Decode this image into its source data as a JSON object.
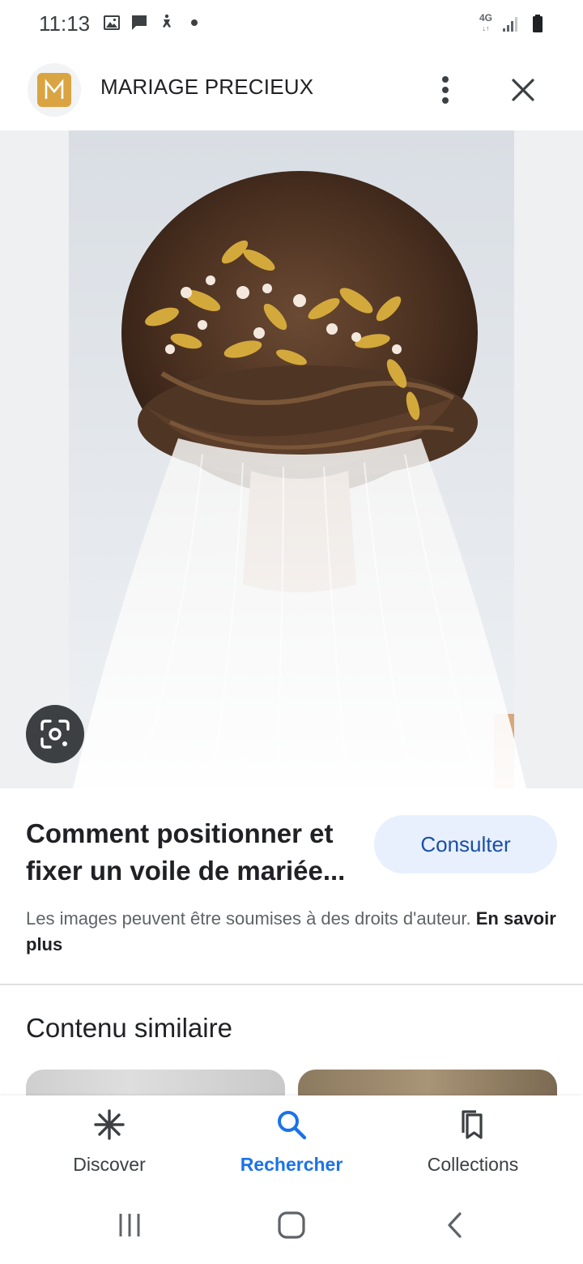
{
  "status_bar": {
    "time": "11:13",
    "network": "4G",
    "left_icons": [
      "gallery-icon",
      "message-icon",
      "accessibility-icon",
      "dot-icon"
    ],
    "right_icons": [
      "network-4g-icon",
      "signal-icon",
      "battery-icon"
    ]
  },
  "header": {
    "site_name": "MARIAGE PRECIEUX",
    "logo_letter": "M",
    "brand_color": "#d9a441"
  },
  "image": {
    "icon": "lens-icon"
  },
  "result": {
    "title": "Comment positionner et fixer un voile de mariée...",
    "consult_label": "Consulter",
    "copyright_text": "Les images peuvent être soumises à des droits d'auteur.",
    "learn_more": "En savoir plus"
  },
  "similar": {
    "heading": "Contenu similaire"
  },
  "bottom_nav": {
    "items": [
      {
        "label": "Discover",
        "icon": "asterisk-icon",
        "active": false
      },
      {
        "label": "Rechercher",
        "icon": "search-icon",
        "active": true
      },
      {
        "label": "Collections",
        "icon": "collections-icon",
        "active": false
      }
    ],
    "accent": "#1a73e8"
  },
  "system_nav": {
    "buttons": [
      "recents-icon",
      "home-icon",
      "back-icon"
    ]
  }
}
